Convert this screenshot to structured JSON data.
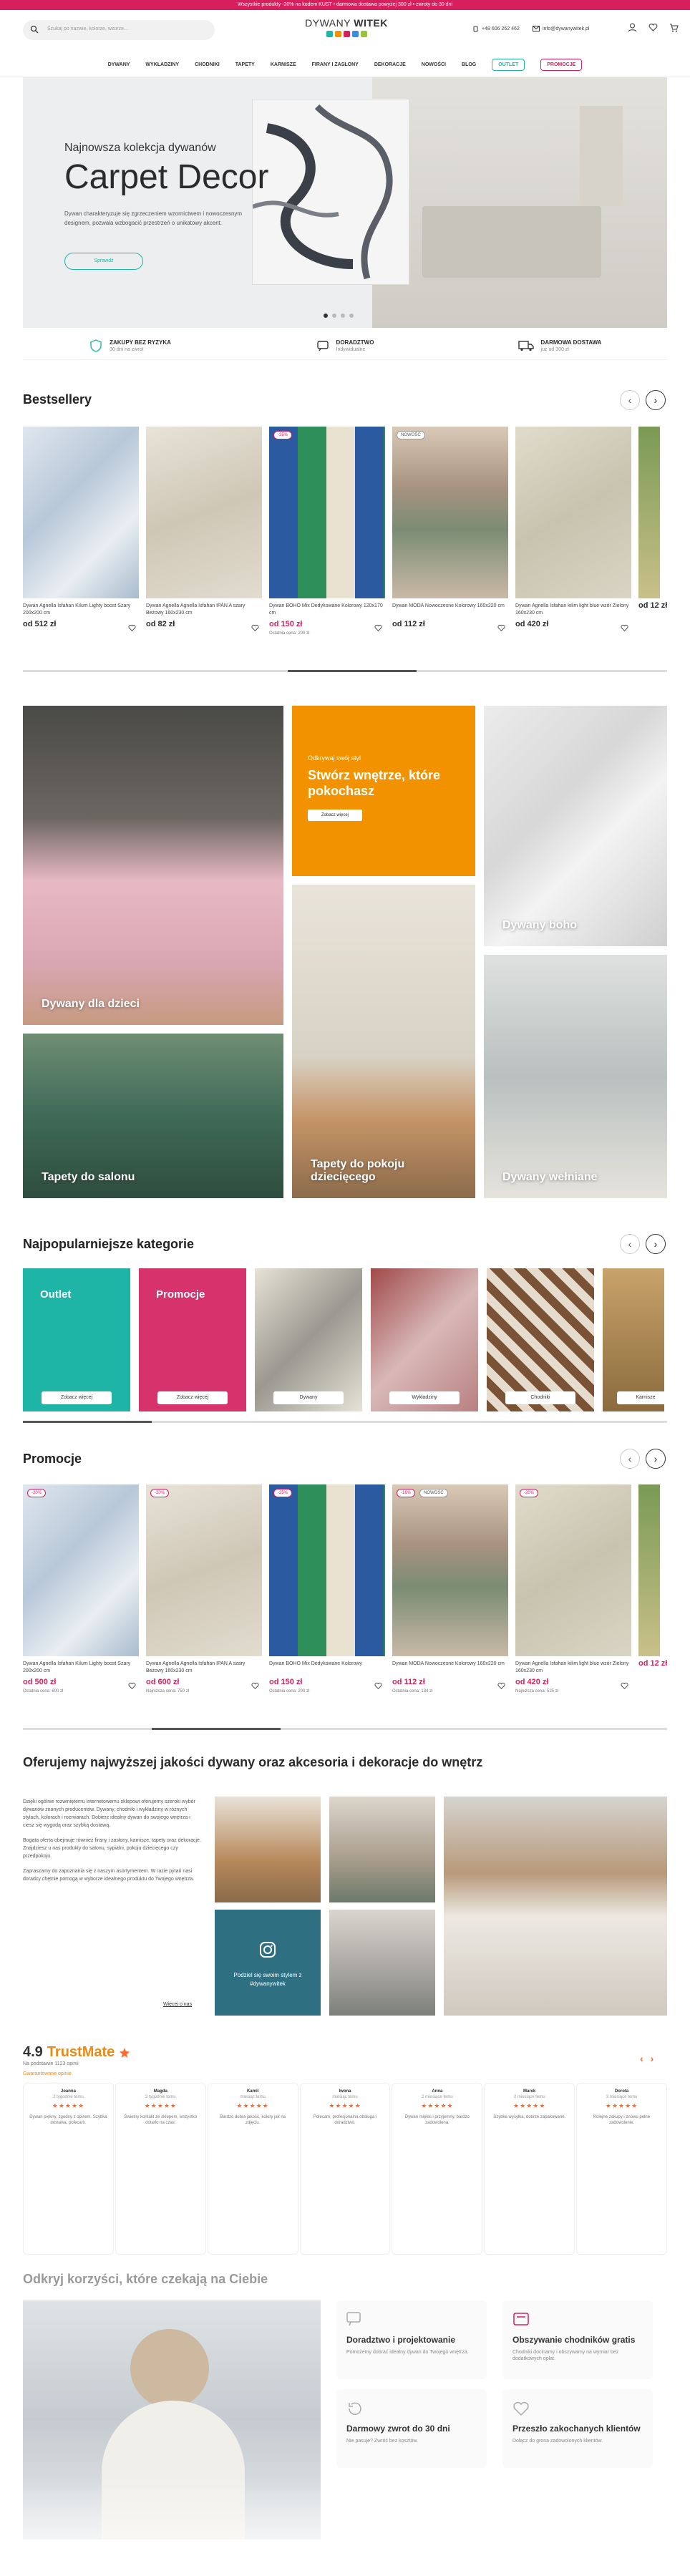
{
  "topbar": {
    "text": "Wszystkie produkty -20% na kodem KUST • darmowa dostawa powyżej 300 zł • zwroty do 30 dni"
  },
  "header": {
    "search_placeholder": "Szukaj po nazwie, kolorze, wzorze...",
    "logo_light": "DYWANY",
    "logo_bold": "WITEK",
    "phone": "+48 606 262 462",
    "email": "info@dywanywitek.pl"
  },
  "nav": [
    "DYWANY",
    "WYKŁADZINY",
    "CHODNIKI",
    "TAPETY",
    "KARNISZE",
    "FIRANY I ZASŁONY",
    "DEKORACJE",
    "NOWOŚCI",
    "BLOG",
    "OUTLET",
    "PROMOCJE"
  ],
  "hero": {
    "subtitle": "Najnowsza kolekcja dywanów",
    "title": "Carpet Decor",
    "description": "Dywan charakteryzuje się zgrzeczeniem wzornictwem i nowoczesnym designem, pozwala wzbogacić przestrzeń o unikatowy akcent.",
    "cta": "Sprawdź"
  },
  "benefits": [
    {
      "title": "ZAKUPY BEZ RYZYKA",
      "sub": "30 dni na zwrot"
    },
    {
      "title": "DORADZTWO",
      "sub": "Indywidualne"
    },
    {
      "title": "DARMOWA DOSTAWA",
      "sub": "już od 300 zł"
    }
  ],
  "bestsellers": {
    "title": "Bestsellery",
    "items": [
      {
        "name": "Dywan Agnella Isfahan Kilum Lighty boost Szary 200x200 cm",
        "price": "od 512 zł",
        "badge": "",
        "badge2": "",
        "old": ""
      },
      {
        "name": "Dywan Agnella Agnella Isfahan IPAN A szary Beżowy 160x230 cm",
        "price": "od 82 zł",
        "badge": "",
        "badge2": "",
        "old": ""
      },
      {
        "name": "Dywan BOHO Mix Dedykowane Kolorowy 120x170 cm",
        "price": "od 150 zł",
        "badge": "-25%",
        "badge2": "",
        "old": "Ostatnia cena: 200 zł"
      },
      {
        "name": "Dywan MODA Nowoczesne Kolorowy 160x220 cm",
        "price": "od 112 zł",
        "badge": "NOWOŚĆ",
        "badge2": "",
        "old": ""
      },
      {
        "name": "Dywan Agnella Isfahan kilim light blue wzór Zielony 160x230 cm",
        "price": "od 420 zł",
        "badge": "",
        "badge2": "",
        "old": ""
      },
      {
        "name": "Dywan Agnella Isfahan",
        "price": "od 12 zł",
        "badge": "",
        "badge2": "",
        "old": ""
      }
    ]
  },
  "tiles": {
    "kids": "Dywany dla dzieci",
    "promo_small": "Odkrywaj swój styl",
    "promo_title": "Stwórz wnętrze, które pokochasz",
    "promo_btn": "Zobacz więcej",
    "boho": "Dywany boho",
    "salon": "Tapety do salonu",
    "pokoj": "Tapety do pokoju dziecięcego",
    "wool": "Dywany wełniane"
  },
  "categories": {
    "title": "Najpopularniejsze kategorie",
    "items": [
      {
        "title": "Outlet",
        "btn": "Zobacz więcej"
      },
      {
        "title": "Promocje",
        "btn": "Zobacz więcej"
      },
      {
        "title": "",
        "btn": "Dywany"
      },
      {
        "title": "",
        "btn": "Wykładziny"
      },
      {
        "title": "",
        "btn": "Chodniki"
      },
      {
        "title": "",
        "btn": "Karnisze"
      }
    ]
  },
  "promos": {
    "title": "Promocje",
    "items": [
      {
        "name": "Dywan Agnella Isfahan Kilum Lighty boost Szary 200x200 cm",
        "price": "od 500 zł",
        "badge": "-20%",
        "badge2": "",
        "old": "Ostatnia cena: 600 zł"
      },
      {
        "name": "Dywan Agnella Agnella Isfahan IPAN A szary Beżowy 160x230 cm",
        "price": "od 600 zł",
        "badge": "-20%",
        "badge2": "",
        "old": "Najniższa cena: 750 zł"
      },
      {
        "name": "Dywan BOHO Mix Dedykowane Kolorowy",
        "price": "od 150 zł",
        "badge": "-25%",
        "badge2": "",
        "old": "Ostatnia cena: 200 zł"
      },
      {
        "name": "Dywan MODA Nowoczesne Kolorowy 160x220 cm",
        "price": "od 112 zł",
        "badge": "-16%",
        "badge2": "NOWOŚĆ",
        "old": "Ostatnia cena: 134 zł"
      },
      {
        "name": "Dywan Agnella Isfahan kilim light blue wzór Zielony 160x230 cm",
        "price": "od 420 zł",
        "badge": "-20%",
        "badge2": "",
        "old": "Najniższa cena: 525 zł"
      },
      {
        "name": "Dywan Agnella",
        "price": "od 12 zł",
        "badge": "",
        "badge2": "",
        "old": ""
      }
    ]
  },
  "about": {
    "title": "Oferujemy najwyższej jakości dywany oraz akcesoria i dekoracje do wnętrz",
    "p1": "Dzięki ogólnie rozwiniętemu internetowemu sklepowi oferujemy szeroki wybór dywanów znanych producentów. Dywany, chodniki i wykładziny w różnych stylach, kolorach i rozmiarach. Dobierz idealny dywan do swojego wnętrza i ciesz się wygodą oraz szybką dostawą.",
    "p2": "Bogata oferta obejmuje również firany i zasłony, karnisze, tapety oraz dekoracje. Znajdziesz u nas produkty do salonu, sypialni, pokoju dziecięcego czy przedpokoju.",
    "p3": "Zapraszamy do zapoznania się z naszym asortymentem. W razie pytań nasi doradcy chętnie pomogą w wyborze idealnego produktu do Twojego wnętrza.",
    "more": "Więcej o nas",
    "insta_text": "Podziel się swoim stylem z #dywanywitek"
  },
  "reviews": {
    "score": "4.9",
    "brand": "TrustMate",
    "sub": "Na podstawie 1123 opinii",
    "badge": "Gwarantowane opinie",
    "items": [
      {
        "name": "Joanna",
        "date": "2 tygodnie temu",
        "text": "Dywan piękny, zgodny z opisem. Szybka dostawa, polecam."
      },
      {
        "name": "Magda",
        "date": "3 tygodnie temu",
        "text": "Świetny kontakt ze sklepem, wszystko dotarło na czas."
      },
      {
        "name": "Kamil",
        "date": "miesiąc temu",
        "text": "Bardzo dobra jakość, kolory jak na zdjęciu."
      },
      {
        "name": "Iwona",
        "date": "miesiąc temu",
        "text": "Polecam, profesjonalna obsługa i doradztwo."
      },
      {
        "name": "Anna",
        "date": "2 miesiące temu",
        "text": "Dywan miękki i przyjemny, bardzo zadowolona."
      },
      {
        "name": "Marek",
        "date": "2 miesiące temu",
        "text": "Szybka wysyłka, dobrze zapakowane."
      },
      {
        "name": "Dorota",
        "date": "3 miesiące temu",
        "text": "Kolejne zakupy i znowu pełne zadowolenie."
      }
    ]
  },
  "features": {
    "title": "Odkryj korzyści, które czekają na Ciebie",
    "items": [
      {
        "title": "Doradztwo i projektowanie",
        "sub": "Pomożemy dobrać idealny dywan do Twojego wnętrza."
      },
      {
        "title": "Obszywanie chodników gratis",
        "sub": "Chodniki docinamy i obszywamy na wymiar bez dodatkowych opłat."
      },
      {
        "title": "Darmowy zwrot do 30 dni",
        "sub": "Nie pasuje? Zwróć bez kosztów."
      },
      {
        "title": "Przeszło zakochanych klientów",
        "sub": "Dołącz do grona zadowolonych klientów."
      }
    ]
  }
}
